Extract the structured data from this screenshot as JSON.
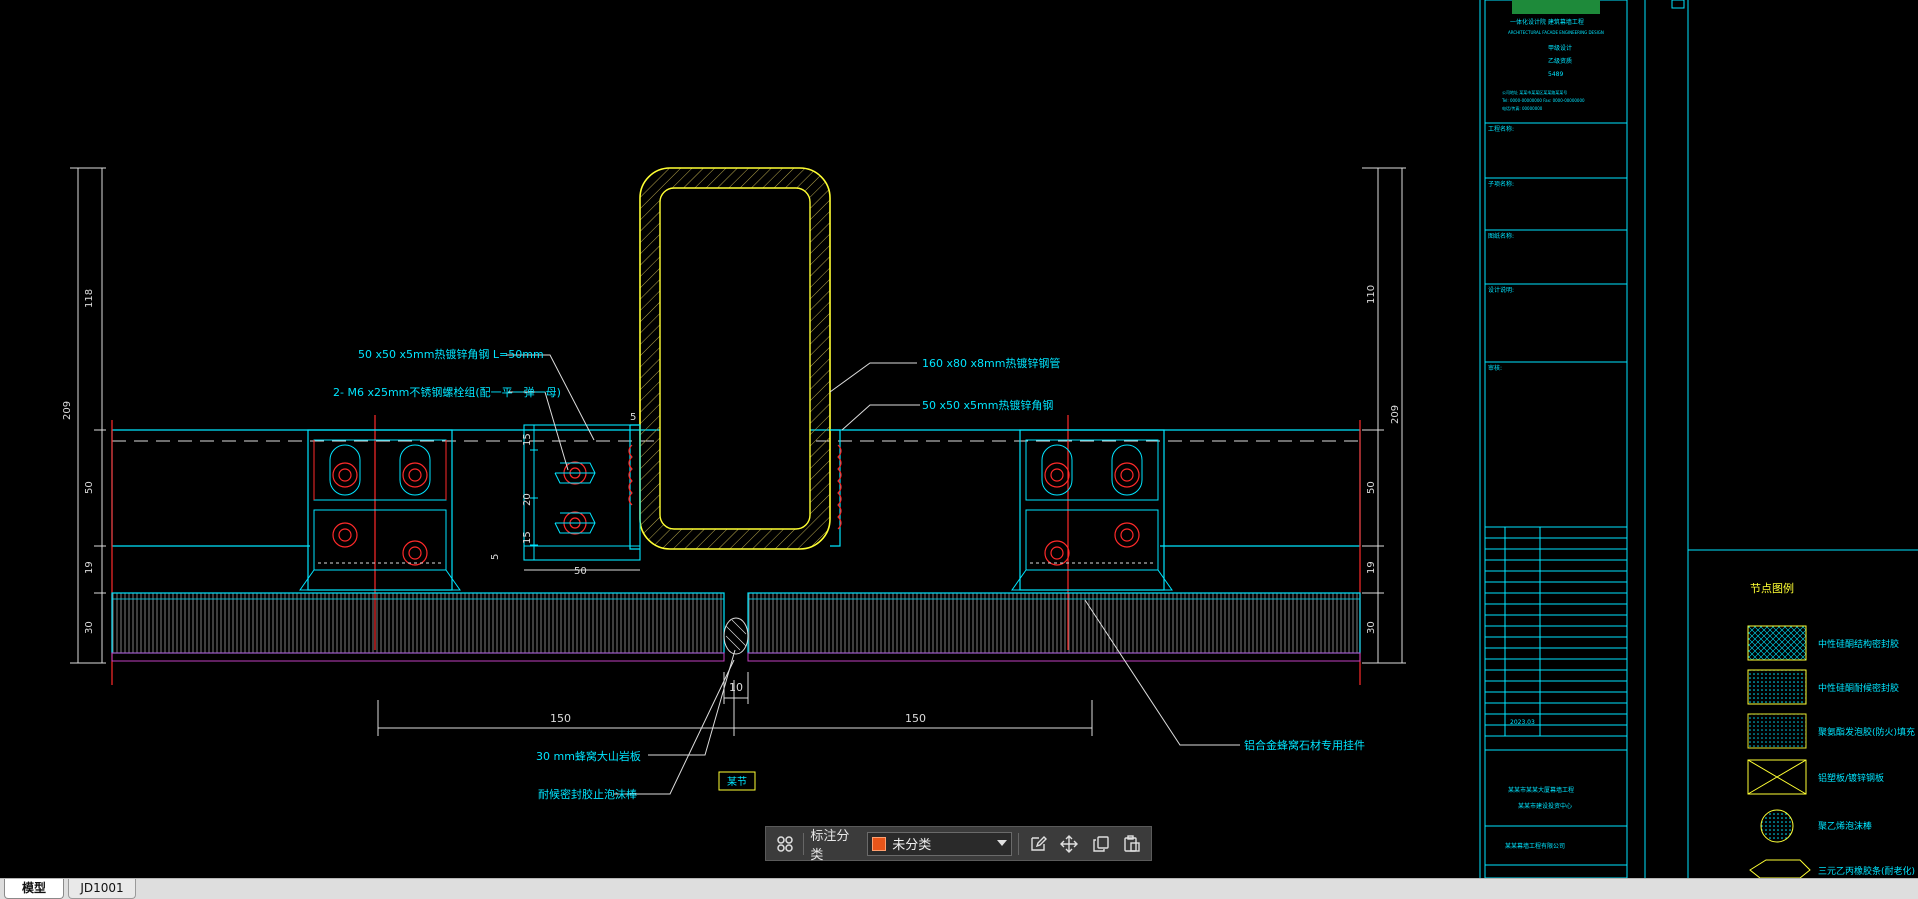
{
  "colors": {
    "background": "#000000",
    "cyan": "#00e5ff",
    "yellow": "#ffff33",
    "red": "#ff2a2a",
    "magenta": "#c040c0",
    "white": "#ffffff",
    "toolbar": "#3b3b3b",
    "swatch": "#e8551a"
  },
  "drawing": {
    "dims_left": [
      "118",
      "209",
      "50",
      "19",
      "30"
    ],
    "dims_right": [
      "110",
      "209",
      "50",
      "19",
      "30"
    ],
    "dims_bottom": [
      "150",
      "150",
      "10"
    ],
    "dims_detail": [
      "15",
      "20",
      "15",
      "5",
      "50",
      "5"
    ],
    "labels": {
      "angle_top": "50 x50 x5mm热镀锌角钢 L=50mm",
      "bolt": "2- M6 x25mm不锈钢螺栓组(配一平一弹一母)",
      "tube": "160 x80 x8mm热镀锌钢管",
      "angle_right": "50 x50 x5mm热镀锌角钢",
      "honeycomb": "30 mm蜂窝大山岩板",
      "sealant": "耐候密封胶止泡沫棒",
      "alu_clip": "铝合金蜂窝石材专用挂件",
      "node_tag": "某节"
    }
  },
  "title_block": {
    "company_cn": "一体化设计院 建筑幕墙工程",
    "company_en": "ARCHITECTURAL FACADE ENGINEERING DESIGN",
    "codes": [
      "甲级设计",
      "乙级资质",
      "5489"
    ],
    "address": [
      "公司地址 某某市某某区某某路某某号",
      "Tel: 0000-00000000 Fax: 0000-00000000",
      "电话/传真: 00000000"
    ],
    "row_labels": [
      "工程名称:",
      "子项名称:",
      "图纸名称:",
      "设计说明:",
      "审核:"
    ],
    "project": "某某市某某大厦幕墙工程",
    "drawing_no": "2023.03",
    "client": "某某市建设投资中心",
    "contractor": "某某幕墙工程有限公司",
    "legend_title": "节点图例",
    "legend_items": [
      "中性硅酮结构密封胶",
      "中性硅酮耐候密封胶",
      "聚氨酯发泡胶(防火)填充",
      "铝塑板/镀锌钢板",
      "聚乙烯泡沫棒",
      "三元乙丙橡胶条(耐老化)"
    ]
  },
  "toolbar": {
    "label": "标注分类",
    "selected": "未分类",
    "icons": [
      "grid-icon",
      "edit-icon",
      "move-icon",
      "copy-icon",
      "paste-icon"
    ]
  },
  "tabs": [
    "模型",
    "JD1001"
  ]
}
